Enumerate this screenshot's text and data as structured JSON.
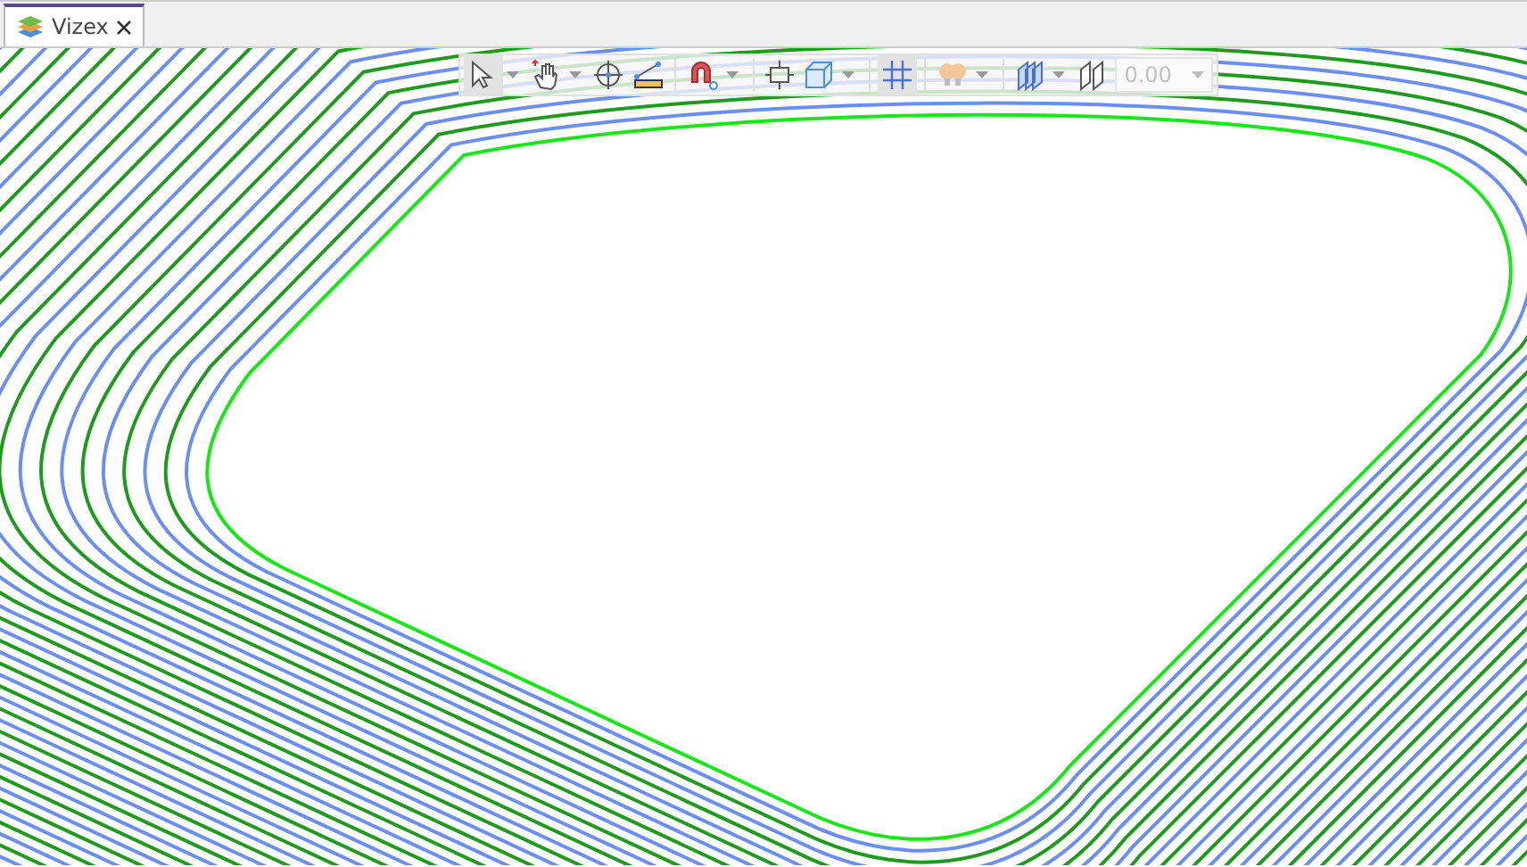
{
  "tabs": [
    {
      "label": "Vizex",
      "selected": true
    }
  ],
  "toolbar": {
    "items": [
      {
        "kind": "select",
        "selected": true,
        "dropdown": true
      },
      {
        "kind": "pan",
        "selected": false,
        "dropdown": true
      },
      {
        "kind": "target",
        "selected": false,
        "dropdown": false
      },
      {
        "kind": "measure",
        "selected": false,
        "dropdown": false
      },
      {
        "kind": "separator"
      },
      {
        "kind": "snap",
        "selected": false,
        "dropdown": true
      },
      {
        "kind": "separator"
      },
      {
        "kind": "fit",
        "selected": false,
        "dropdown": false
      },
      {
        "kind": "cube",
        "selected": false,
        "dropdown": true
      },
      {
        "kind": "separator"
      },
      {
        "kind": "grid",
        "selected": true,
        "dropdown": false
      },
      {
        "kind": "separator"
      },
      {
        "kind": "lights",
        "selected": false,
        "dropdown": true
      },
      {
        "kind": "separator"
      },
      {
        "kind": "sections",
        "selected": false,
        "dropdown": true
      },
      {
        "kind": "planes",
        "selected": false,
        "dropdown": false
      },
      {
        "kind": "field",
        "value": "0.00",
        "disabled": true
      }
    ]
  }
}
